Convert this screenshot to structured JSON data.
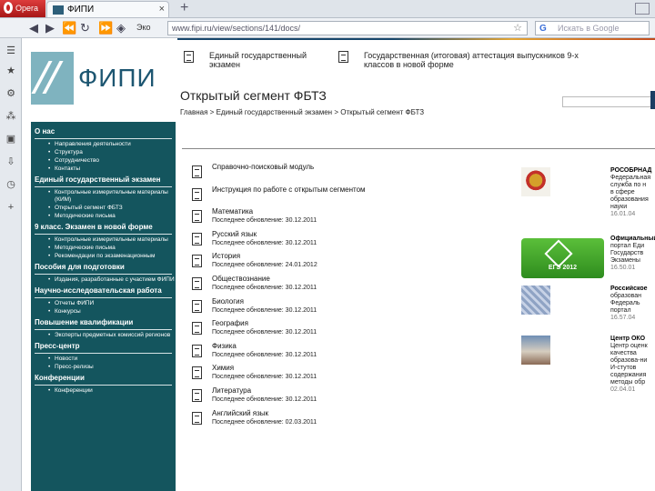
{
  "browser": {
    "menu_label": "Opera",
    "tab_title": "ФИПИ",
    "tab_close": "×",
    "new_tab": "+",
    "eco_label": "Эко",
    "url": "www.fipi.ru/view/sections/141/docs/",
    "search_placeholder": "Искать в Google"
  },
  "header": {
    "link1": "Единый государственный экзамен",
    "link2": "Государственная (итоговая) аттестация выпускников 9-х классов в новой форме",
    "logo_text": "ФИПИ",
    "page_title": "Открытый сегмент ФБТЗ",
    "breadcrumb": "Главная > Единый государственный экзамен > Открытый сегмент ФБТЗ"
  },
  "sidebar": {
    "sections": [
      {
        "title": "О нас",
        "items": [
          "Направления деятельности",
          "Структура",
          "Сотрудничество",
          "Контакты"
        ]
      },
      {
        "title": "Единый государственный экзамен",
        "items": [
          "Контрольные измерительные материалы (КИМ)",
          "Открытый сегмент ФБТЗ",
          "Методические письма"
        ]
      },
      {
        "title": "9 класс. Экзамен в новой форме",
        "items": [
          "Контрольные измерительные материалы",
          "Методические письма",
          "Рекомендации по экзаменационным"
        ]
      },
      {
        "title": "Пособия для подготовки",
        "items": [
          "Издания, разработанные с участием ФИПИ"
        ]
      },
      {
        "title": "Научно-исследовательская работа",
        "items": [
          "Отчеты ФИПИ",
          "Конкурсы"
        ]
      },
      {
        "title": "Повышение квалификации",
        "items": [
          "Эксперты предметных комиссий регионов"
        ]
      },
      {
        "title": "Пресс-центр",
        "items": [
          "Новости",
          "Пресс-релизы"
        ]
      },
      {
        "title": "Конференции",
        "items": [
          "Конференции"
        ]
      }
    ]
  },
  "docs": [
    {
      "title": "Справочно-поисковый модуль",
      "date": ""
    },
    {
      "title": "Инструкция по работе с открытым сегментом",
      "date": ""
    },
    {
      "title": "Математика",
      "date": "Последнее обновление: 30.12.2011"
    },
    {
      "title": "Русский язык",
      "date": "Последнее обновление: 30.12.2011"
    },
    {
      "title": "История",
      "date": "Последнее обновление: 24.01.2012"
    },
    {
      "title": "Обществознание",
      "date": "Последнее обновление: 30.12.2011"
    },
    {
      "title": "Биология",
      "date": "Последнее обновление: 30.12.2011"
    },
    {
      "title": "География",
      "date": "Последнее обновление: 30.12.2011"
    },
    {
      "title": "Физика",
      "date": "Последнее обновление: 30.12.2011"
    },
    {
      "title": "Химия",
      "date": "Последнее обновление: 30.12.2011"
    },
    {
      "title": "Литература",
      "date": "Последнее обновление: 30.12.2011"
    },
    {
      "title": "Английский язык",
      "date": "Последнее обновление: 02.03.2011"
    }
  ],
  "right": {
    "ege_badge": "ЕГЭ 2012",
    "blocks": [
      {
        "title": "РОСОБРНАД",
        "lines": [
          "Федеральная",
          "служба по н",
          "в сфере",
          "образования",
          "науки"
        ],
        "date": "16.01.04"
      },
      {
        "title": "Официальный",
        "lines": [
          "портал Еди",
          "Государств",
          "Экзамены"
        ],
        "date": "16.50.01"
      },
      {
        "title": "Российское",
        "lines": [
          "образован",
          "Федераль",
          "портал"
        ],
        "date": "16.57.04"
      },
      {
        "title": "Центр ОКО",
        "lines": [
          "Центр оценк",
          "качества",
          "образова-ни",
          "И-стутов",
          "содержания",
          "методы обр"
        ],
        "date": "02.04.01"
      }
    ]
  }
}
